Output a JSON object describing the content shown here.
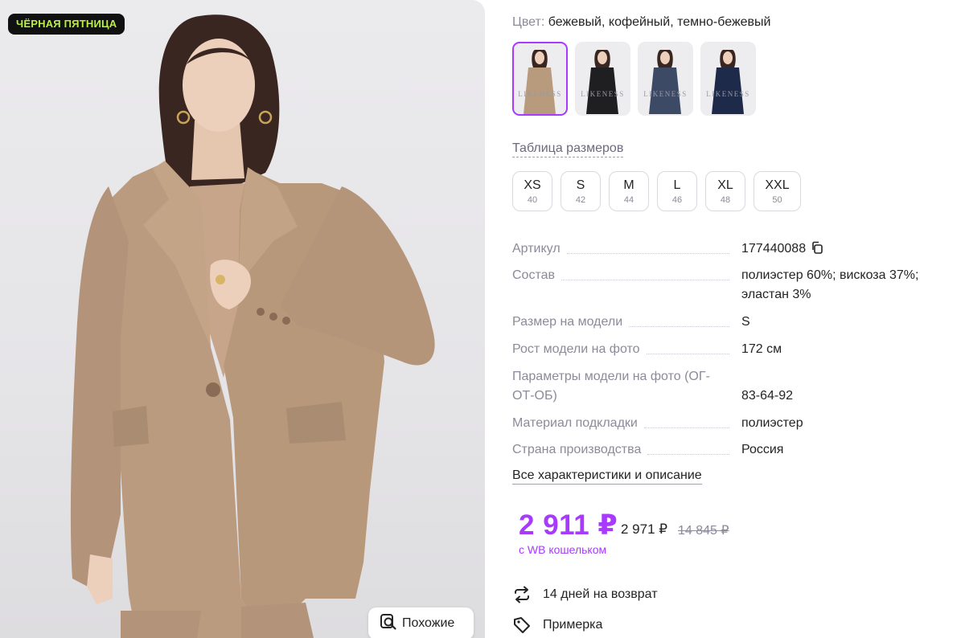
{
  "photo": {
    "promo_badge": "ЧЁРНАЯ ПЯТНИЦА",
    "similar_button": "Похожие"
  },
  "color": {
    "label": "Цвет:",
    "value": "бежевый, кофейный, темно-бежевый"
  },
  "swatches": [
    {
      "brand": "LIKENESS",
      "selected": true,
      "jacket_color": "#b89a7c"
    },
    {
      "brand": "LIKENESS",
      "selected": false,
      "jacket_color": "#1f1f22"
    },
    {
      "brand": "LIKENESS",
      "selected": false,
      "jacket_color": "#3d4a66"
    },
    {
      "brand": "LIKENESS",
      "selected": false,
      "jacket_color": "#1d2a4a"
    }
  ],
  "size_table_link": "Таблица размеров",
  "sizes": [
    {
      "name": "XS",
      "ru": "40"
    },
    {
      "name": "S",
      "ru": "42"
    },
    {
      "name": "M",
      "ru": "44"
    },
    {
      "name": "L",
      "ru": "46"
    },
    {
      "name": "XL",
      "ru": "48"
    },
    {
      "name": "XXL",
      "ru": "50"
    }
  ],
  "specs": [
    {
      "key": "Артикул",
      "value": "177440088"
    },
    {
      "key": "Состав",
      "value": "полиэстер 60%; вискоза 37%; эластан 3%"
    },
    {
      "key": "Размер на модели",
      "value": "S"
    },
    {
      "key": "Рост модели на фото",
      "value": "172 см"
    },
    {
      "key": "Параметры модели на фото (ОГ-ОТ-ОБ)",
      "value": "83-64-92"
    },
    {
      "key": "Материал подкладки",
      "value": "полиэстер"
    },
    {
      "key": "Страна производства",
      "value": "Россия"
    }
  ],
  "all_characteristics_link": "Все характеристики и описание",
  "price": {
    "current": "2 911 ₽",
    "before_wallet": "2 971 ₽",
    "original": "14 845 ₽",
    "note": "с WB кошельком"
  },
  "features": [
    {
      "icon": "return-arrows-icon",
      "label": "14 дней на возврат"
    },
    {
      "icon": "tag-icon",
      "label": "Примерка"
    }
  ],
  "colors": {
    "accent": "#a73afd",
    "badge_bg": "#111111",
    "badge_text": "#b8f23c",
    "muted_text": "#8b8b99"
  }
}
